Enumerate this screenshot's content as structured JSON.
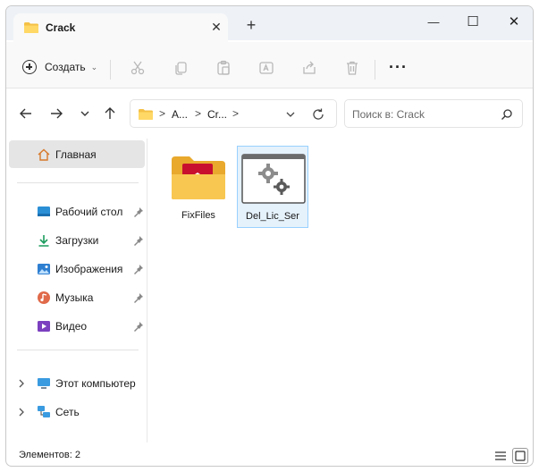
{
  "tab": {
    "title": "Crack",
    "close_glyph": "✕",
    "new_tab_glyph": "+"
  },
  "window_controls": {
    "minimize": "—",
    "maximize": "☐",
    "close": "✕"
  },
  "toolbar": {
    "create_label": "Создать",
    "icons": [
      "cut-icon",
      "copy-icon",
      "paste-icon",
      "rename-icon",
      "share-icon",
      "delete-icon"
    ],
    "more_glyph": "···"
  },
  "address": {
    "crumbs": [
      "A...",
      "Cr..."
    ],
    "separator": ">"
  },
  "search": {
    "placeholder": "Поиск в: Crack"
  },
  "sidebar": {
    "home": "Главная",
    "pinned": [
      {
        "label": "Рабочий стол",
        "icon": "desktop-icon"
      },
      {
        "label": "Загрузки",
        "icon": "downloads-icon"
      },
      {
        "label": "Изображения",
        "icon": "pictures-icon"
      },
      {
        "label": "Музыка",
        "icon": "music-icon"
      },
      {
        "label": "Видео",
        "icon": "video-icon"
      }
    ],
    "devices": [
      {
        "label": "Этот компьютер",
        "icon": "computer-icon"
      },
      {
        "label": "Сеть",
        "icon": "network-icon"
      }
    ]
  },
  "files": [
    {
      "name": "FixFiles",
      "type": "folder",
      "selected": false
    },
    {
      "name": "Del_Lic_Ser",
      "type": "application",
      "selected": true
    }
  ],
  "status": {
    "count": "Элементов: 2"
  },
  "colors": {
    "accent": "#0067c0",
    "folder": "#f4c146",
    "selection": "#e5f1fb",
    "selection_border": "#99d1ff"
  }
}
